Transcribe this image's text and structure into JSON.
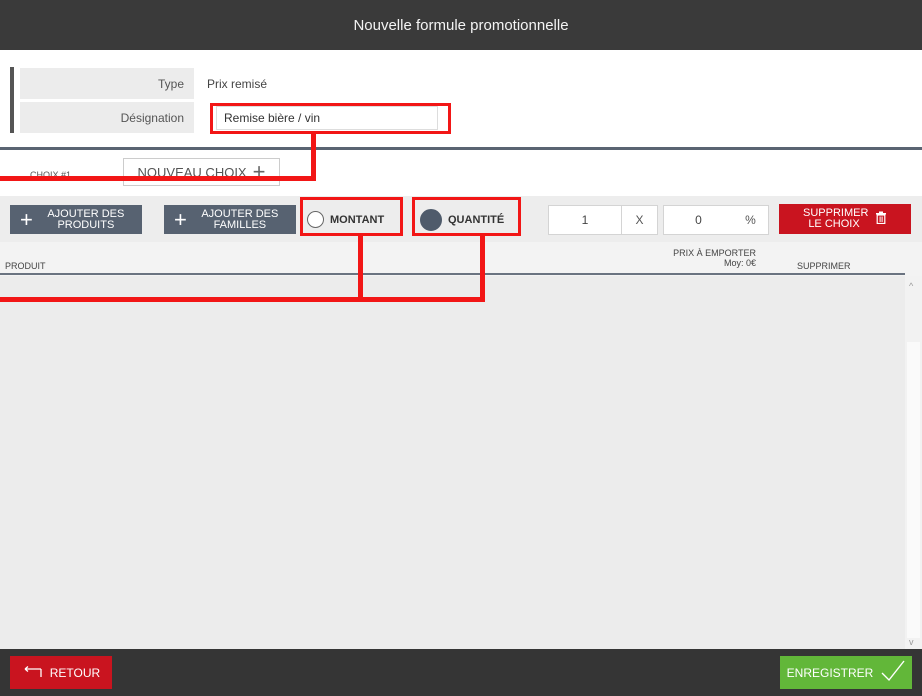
{
  "header": {
    "title": "Nouvelle formule promotionnelle"
  },
  "info": {
    "type_label": "Type",
    "type_value": "Prix remisé",
    "designation_label": "Désignation",
    "designation_value": "Remise bière / vin"
  },
  "choices": {
    "current_tab": "CHOIX #1",
    "new_choice_label": "NOUVEAU CHOIX"
  },
  "toolbar": {
    "add_products_label": "AJOUTER DES PRODUITS",
    "add_families_label": "AJOUTER DES FAMILLES",
    "amount_label": "MONTANT",
    "quantity_label": "QUANTITÉ",
    "selected_mode": "QUANTITÉ",
    "quantity_value": "1",
    "quantity_suffix": "X",
    "percent_value": "0",
    "percent_suffix": "%",
    "delete_choice_label": "SUPPRIMER LE CHOIX"
  },
  "table": {
    "col_product": "PRODUIT",
    "col_price_line1": "PRIX À EMPORTER",
    "col_price_line2": "Moy: 0€",
    "col_delete": "SUPPRIMER",
    "rows": []
  },
  "footer": {
    "back_label": "RETOUR",
    "save_label": "ENREGISTRER"
  },
  "colors": {
    "header_bg": "#3a3a3a",
    "primary_btn": "#576271",
    "danger": "#c9141f",
    "success": "#62b739",
    "annotation": "#f21616"
  },
  "icons": {
    "plus": "plus-icon",
    "trash": "trash-icon",
    "back_arrow": "back-arrow-icon",
    "check": "check-icon"
  }
}
